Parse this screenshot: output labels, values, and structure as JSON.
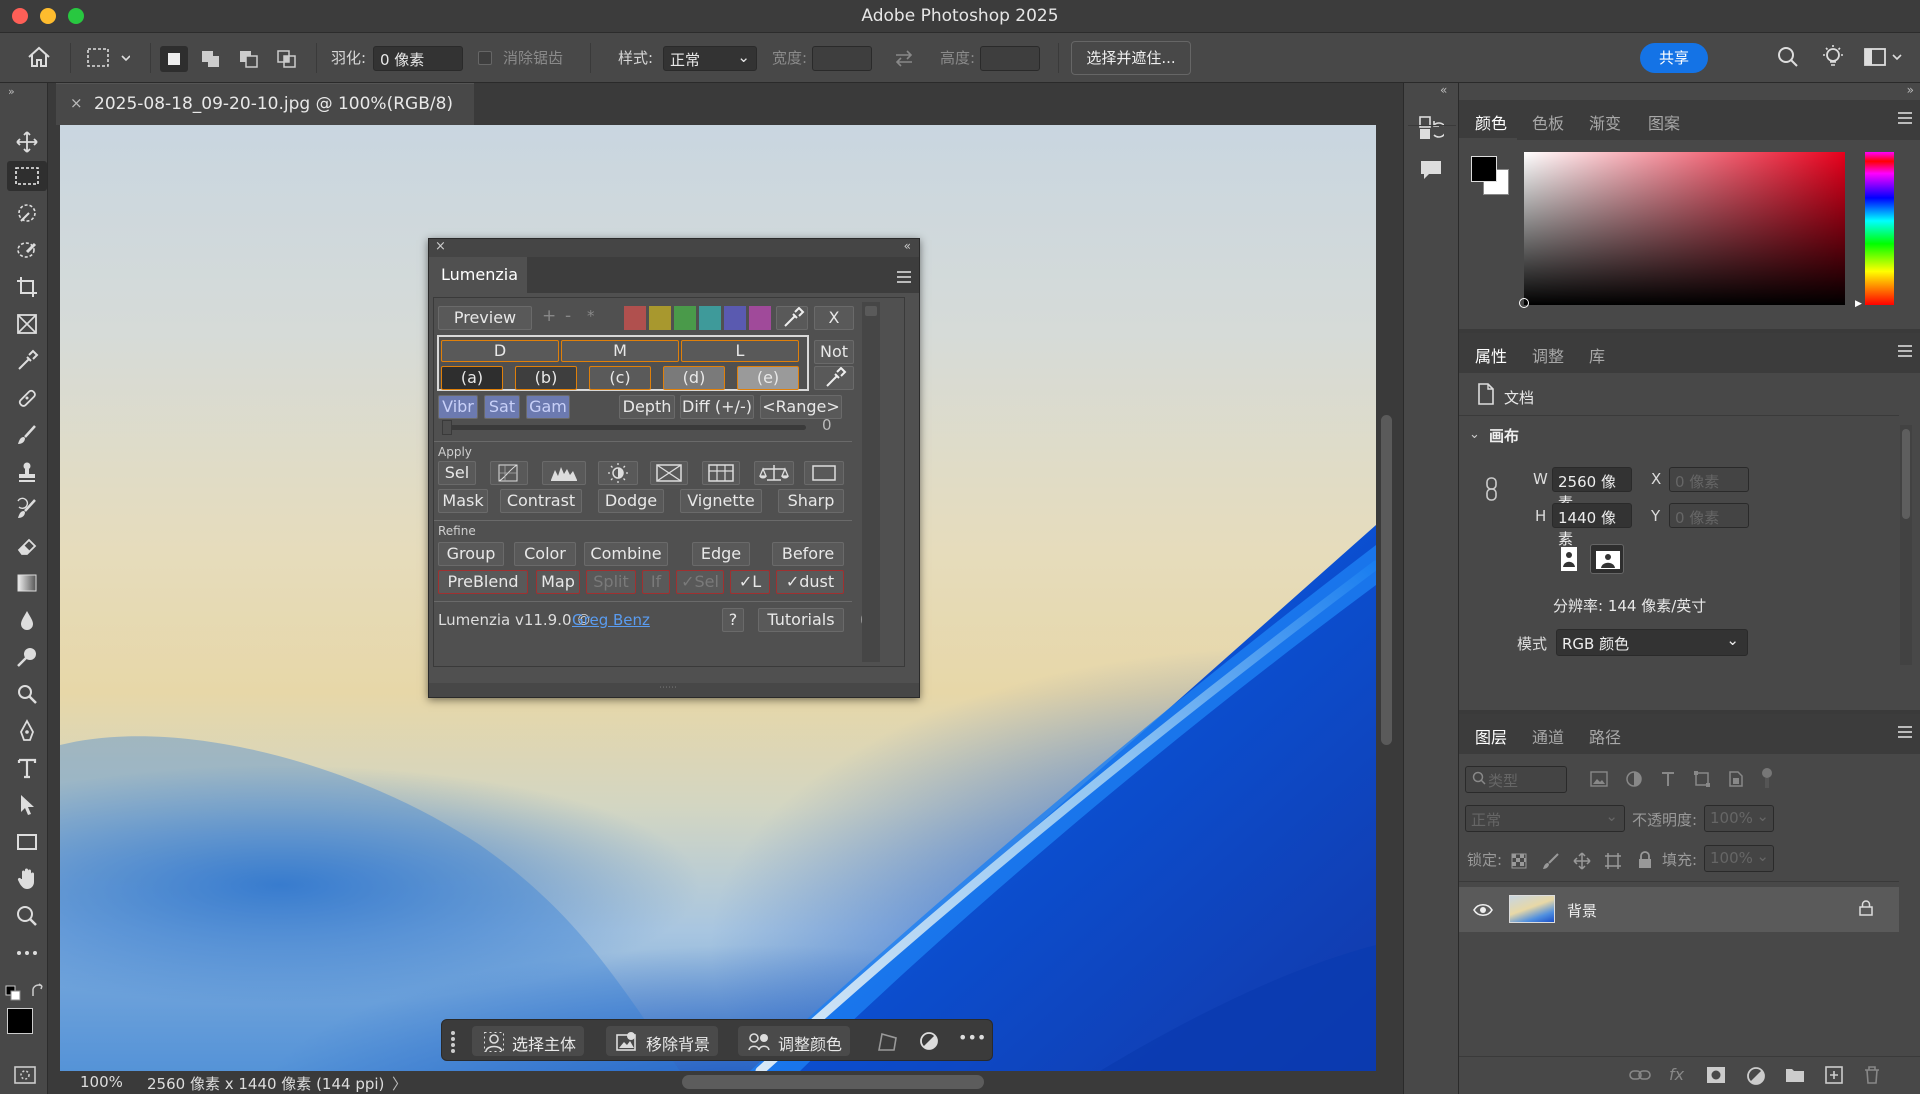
{
  "app": {
    "title": "Adobe Photoshop 2025"
  },
  "options": {
    "feather_label": "羽化:",
    "feather_value": "0 像素",
    "antialias_label": "消除锯齿",
    "style_label": "样式:",
    "style_value": "正常",
    "width_label": "宽度:",
    "height_label": "高度:",
    "select_mask_button": "选择并遮住...",
    "share_button": "共享"
  },
  "document": {
    "tab_title": "2025-08-18_09-20-10.jpg @ 100%(RGB/8)",
    "zoom": "100%",
    "info": "2560 像素 x 1440 像素 (144 ppi)",
    "info_arrow": "〉"
  },
  "lumenzia": {
    "title": "Lumenzia",
    "preview": "Preview",
    "plus": "+",
    "minus": "-",
    "star": "*",
    "x": "X",
    "zones": [
      "D",
      "M",
      "L"
    ],
    "not": "Not",
    "levels": [
      "(a)",
      "(b)",
      "(c)",
      "(d)",
      "(e)"
    ],
    "vibr": "Vibr",
    "sat": "Sat",
    "gam": "Gam",
    "depth": "Depth",
    "diff": "Diff (+/-)",
    "range": "<Range>",
    "slider_value": "0",
    "apply_label": "Apply",
    "apply_buttons": [
      "Mask",
      "Contrast",
      "Dodge",
      "Vignette",
      "Sharp"
    ],
    "sel": "Sel",
    "refine_label": "Refine",
    "refine_row1": [
      "Group",
      "Color",
      "Combine",
      "Edge",
      "Before"
    ],
    "refine_row2": {
      "preblend": "PreBlend",
      "map": "Map",
      "split": "Split",
      "if": "If",
      "vsel": "✓Sel",
      "vl": "✓L",
      "vdust": "✓dust"
    },
    "footer_text": "Lumenzia v11.9.0 ©",
    "author": "Greg Benz",
    "help": "?",
    "tutorials": "Tutorials",
    "counter": "0"
  },
  "color_panel": {
    "tabs": [
      "颜色",
      "色板",
      "渐变",
      "图案"
    ]
  },
  "properties_panel": {
    "tabs": [
      "属性",
      "调整",
      "库"
    ],
    "doc_label": "文档",
    "canvas_section": "画布",
    "w_label": "W",
    "w_value": "2560 像素",
    "h_label": "H",
    "h_value": "1440 像素",
    "x_label": "X",
    "x_value": "0 像素",
    "y_label": "Y",
    "y_value": "0 像素",
    "resolution": "分辨率: 144 像素/英寸",
    "mode_label": "模式",
    "mode_value": "RGB 颜色"
  },
  "layers_panel": {
    "tabs": [
      "图层",
      "通道",
      "路径"
    ],
    "filter_placeholder": "类型",
    "blend_mode": "正常",
    "opacity_label": "不透明度:",
    "opacity_value": "100%",
    "lock_label": "锁定:",
    "fill_label": "填充:",
    "fill_value": "100%",
    "layer_name": "背景"
  },
  "bottom_bar": {
    "select_subject": "选择主体",
    "remove_bg": "移除背景",
    "adjust_color": "调整颜色",
    "more": "•••"
  },
  "colors": {
    "accent": "#1473e6",
    "canvas_blue": "#1f5fd0"
  }
}
